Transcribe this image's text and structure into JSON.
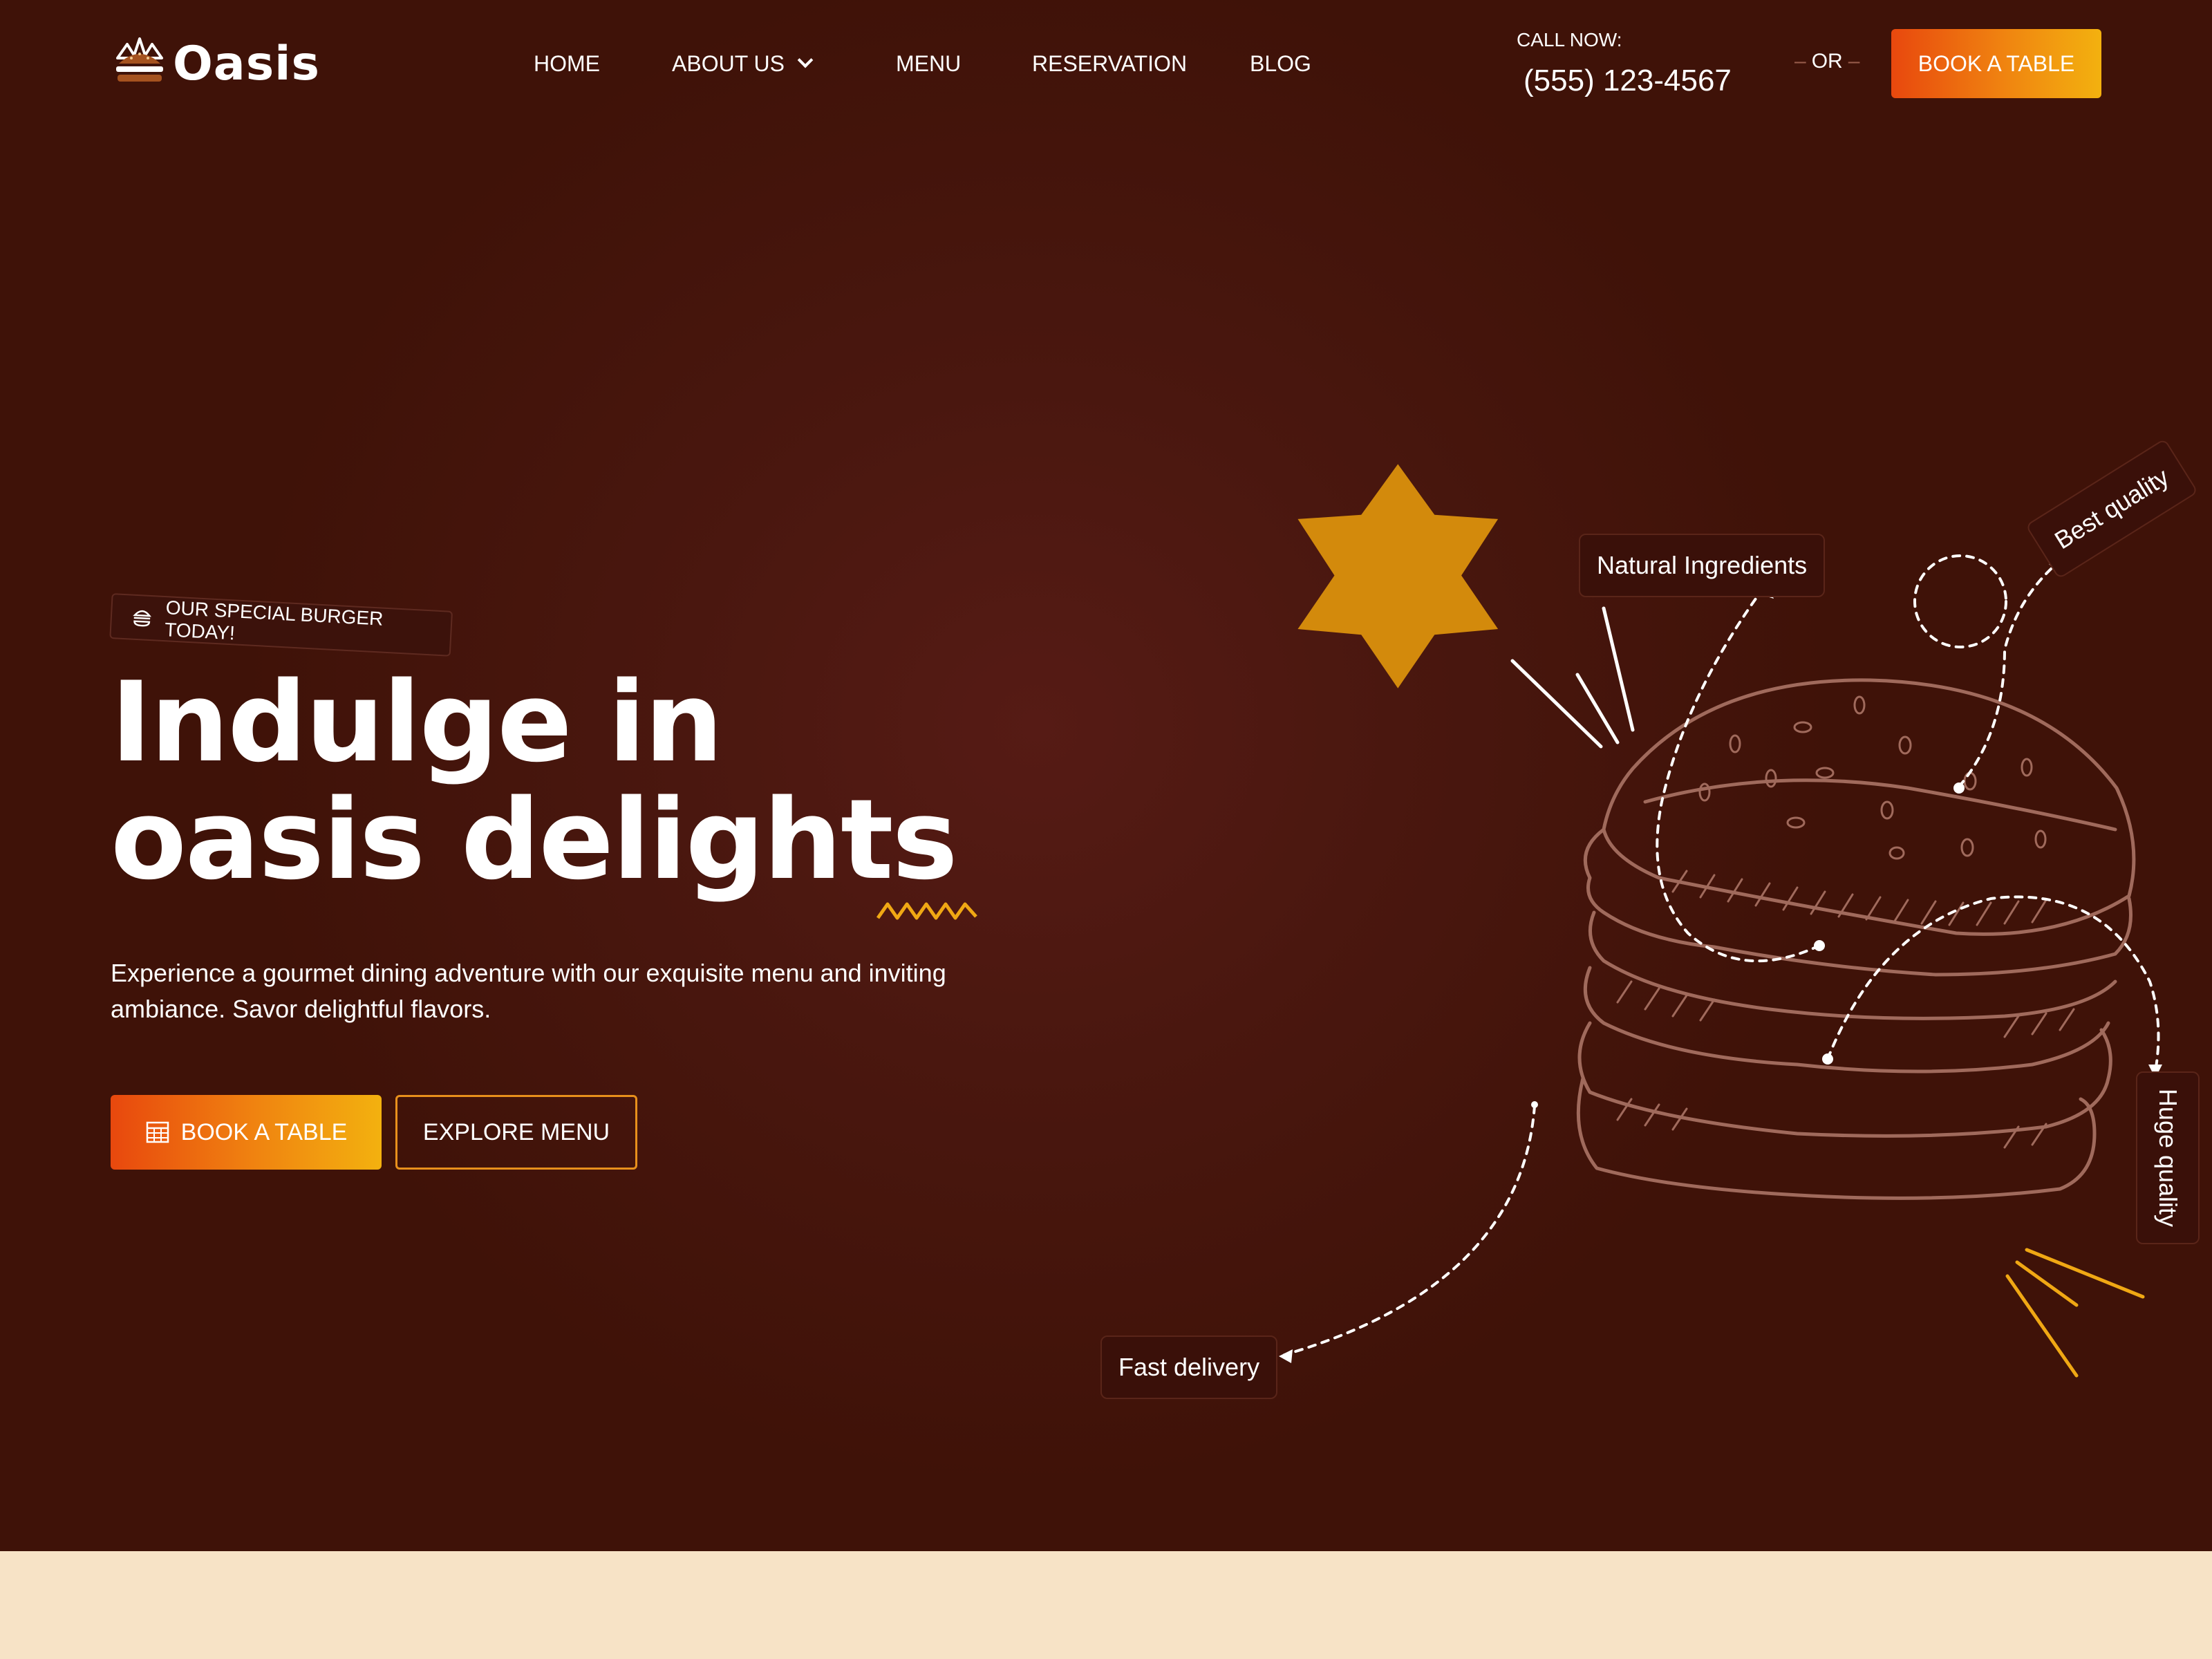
{
  "brand": {
    "name": "Oasis"
  },
  "nav": {
    "items": [
      {
        "label": "HOME"
      },
      {
        "label": "ABOUT US",
        "has_dropdown": true
      },
      {
        "label": "MENU"
      },
      {
        "label": "RESERVATION"
      },
      {
        "label": "BLOG"
      }
    ],
    "call_label": "CALL NOW:",
    "phone": "(555) 123-4567",
    "or_label": "OR",
    "book_label": "BOOK A TABLE"
  },
  "hero": {
    "tag": "OUR SPECIAL BURGER TODAY!",
    "headline_line1": "Indulge in",
    "headline_line2": "oasis delights",
    "subtext": "Experience a gourmet dining adventure with our exquisite menu and inviting ambiance. Savor delightful flavors.",
    "primary_button": "BOOK A TABLE",
    "secondary_button": "EXPLORE MENU"
  },
  "features": {
    "natural": "Natural Ingredients",
    "best": "Best quality",
    "huge": "Huge quality",
    "fast": "Fast delivery"
  },
  "colors": {
    "background": "#4a170f",
    "accent_orange": "#e8480e",
    "accent_yellow": "#f3b10f",
    "star": "#d38a0c",
    "band": "#f7e3c6"
  },
  "icons": {
    "logo": "burger-crown-icon",
    "tag": "burger-icon",
    "button": "table-grid-icon",
    "dropdown": "chevron-down-icon"
  }
}
